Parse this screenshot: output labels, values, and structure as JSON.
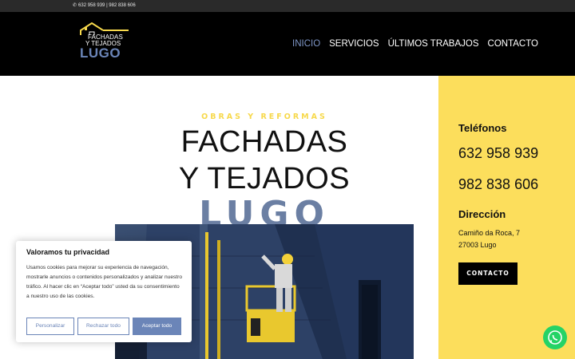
{
  "topbar": {
    "phone_icon": "phone-icon",
    "phones": "632 958 939 | 982 838 606"
  },
  "logo": {
    "line1": "FACHADAS",
    "line2": "Y TEJADOS",
    "line3": "LUGO",
    "roof_color": "#f7d94c",
    "accent": "#6b85b8"
  },
  "nav": {
    "items": [
      "INICIO",
      "SERVICIOS",
      "ÚLTIMOS TRABAJOS",
      "CONTACTO"
    ],
    "active": "INICIO",
    "active_color": "#7d95c6"
  },
  "hero": {
    "eyebrow": "OBRAS Y REFORMAS",
    "title_line1": "FACHADAS",
    "title_line2": "Y TEJADOS",
    "title_line3": "LUGO",
    "eyebrow_color": "#f7d94c",
    "lugo_color": "#6b7fa3"
  },
  "sidebar": {
    "bg_color": "#fcde5c",
    "phones_heading": "Teléfonos",
    "phone1": "632 958 939",
    "phone2": "982 838 606",
    "address_heading": "Dirección",
    "address_line1": "Camiño da Roca, 7",
    "address_line2": "27003 Lugo",
    "contact_button": "CONTACTO"
  },
  "cookie": {
    "title": "Valoramos tu privacidad",
    "body": "Usamos cookies para mejorar su experiencia de navegación, mostrarle anuncios o contenidos personalizados y analizar nuestro tráfico. Al hacer clic en “Aceptar todo” usted da su consentimiento a nuestro uso de las cookies.",
    "btn_customize": "Personalizar",
    "btn_reject": "Rechazar todo",
    "btn_accept": "Aceptar todo",
    "accent": "#6b85b8"
  },
  "whatsapp": {
    "icon": "whatsapp-icon",
    "color": "#25d366"
  }
}
